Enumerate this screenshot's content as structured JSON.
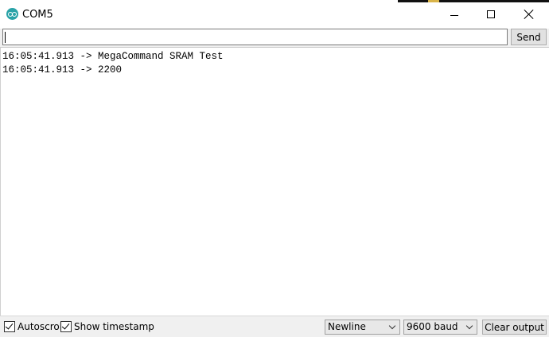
{
  "window": {
    "title": "COM5",
    "app_icon": "arduino-icon"
  },
  "input": {
    "value": "",
    "send_label": "Send"
  },
  "output": {
    "lines": [
      "16:05:41.913 -> MegaCommand SRAM Test",
      "16:05:41.913 -> 2200"
    ]
  },
  "bottom": {
    "autoscroll_label": "Autoscroll",
    "autoscroll_checked": true,
    "timestamp_label": "Show timestamp",
    "timestamp_checked": true,
    "line_ending": "Newline",
    "baud": "9600 baud",
    "clear_label": "Clear output"
  },
  "colors": {
    "icon_accent": "#2aa3a8",
    "chrome_bg": "#f0f0f0",
    "button_bg": "#e1e1e1"
  }
}
